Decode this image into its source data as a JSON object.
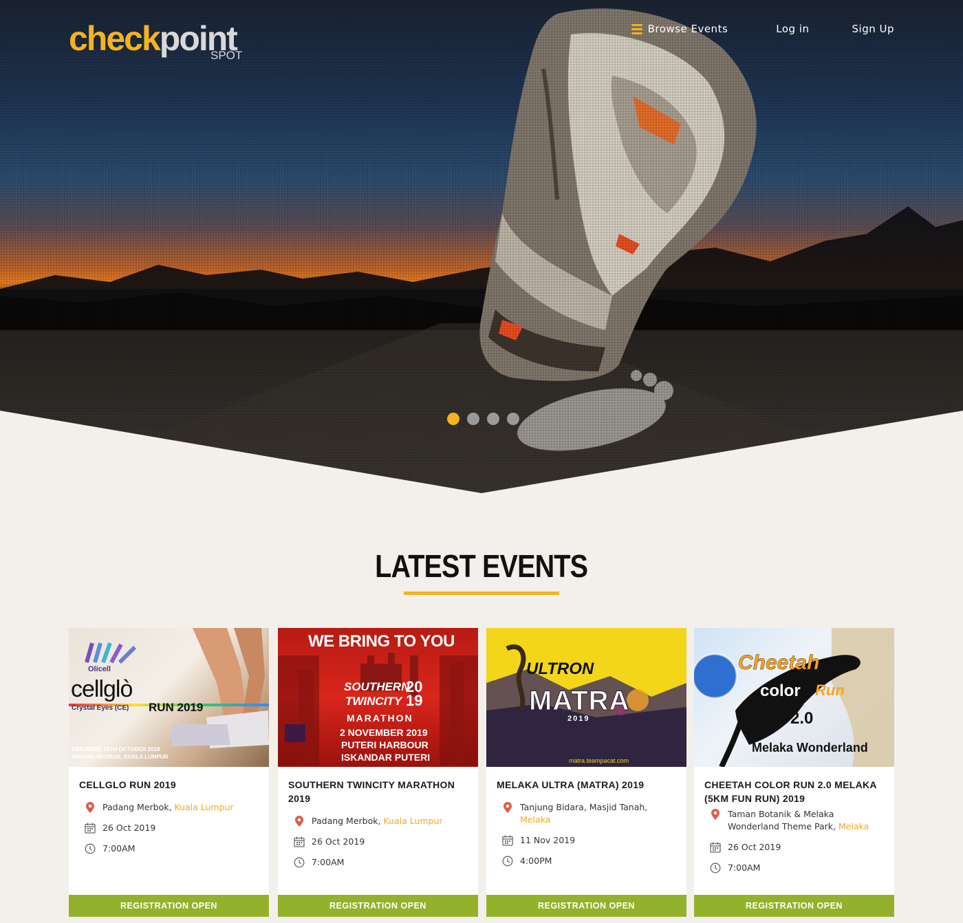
{
  "brand": {
    "logo_main_1": "check",
    "logo_main_2": "point",
    "logo_sub": "SPOT"
  },
  "nav": {
    "browse_label": "Browse Events",
    "login_label": "Log in",
    "signup_label": "Sign Up"
  },
  "carousel": {
    "slide_count": 4,
    "active_index": 0
  },
  "section": {
    "title": "LATEST EVENTS"
  },
  "colors": {
    "accent": "#f5b31f",
    "cta_green": "#93b22b",
    "background": "#f3f0eb"
  },
  "events": [
    {
      "title": "CELLGLO RUN 2019",
      "venue": "Padang Merbok, ",
      "city": "Kuala Lumpur",
      "date": "26 Oct 2019",
      "time": "7:00AM",
      "cta": "REGISTRATION OPEN",
      "poster": {
        "brand": "Olicell",
        "name": "cellglò",
        "tag": "Crystal Eyes (CE)",
        "run": "RUN 2019",
        "line1": "SATURDAY, 26TH OCTOBER 2019",
        "line2": "PADANG MERBOK, KUALA LUMPUR"
      }
    },
    {
      "title": "SOUTHERN TWINCITY MARATHON 2019",
      "venue": "Padang Merbok, ",
      "city": "Kuala Lumpur",
      "date": "26 Oct 2019",
      "time": "7:00AM",
      "cta": "REGISTRATION OPEN",
      "poster": {
        "banner": "WE BRING TO YOU",
        "name1": "SOUTHERN",
        "name2": "TWINCITY",
        "year": "2019",
        "sub": "MARATHON",
        "date": "2 NOVEMBER 2019",
        "loc1": "PUTERI HARBOUR",
        "loc2": "ISKANDAR PUTERI"
      }
    },
    {
      "title": "MELAKA ULTRA (MATRA) 2019",
      "venue": "Tanjung Bidara, Masjid Tanah, ",
      "city": "Melaka",
      "date": "11 Nov 2019",
      "time": "4:00PM",
      "cta": "REGISTRATION OPEN",
      "poster": {
        "brand": "ULTRON",
        "name": "MATRA",
        "year": "2019",
        "url": "matra.teampacat.com"
      }
    },
    {
      "title": "CHEETAH COLOR RUN 2.0 MELAKA (5KM FUN RUN) 2019",
      "venue": "Taman Botanik & Melaka Wonderland Theme Park, ",
      "city": "Melaka",
      "date": "26 Oct 2019",
      "time": "7:00AM",
      "cta": "REGISTRATION OPEN",
      "poster": {
        "name1": "Cheetah",
        "name2": "color",
        "name3": "Run",
        "version": "2.0",
        "place": "Melaka Wonderland"
      }
    }
  ]
}
